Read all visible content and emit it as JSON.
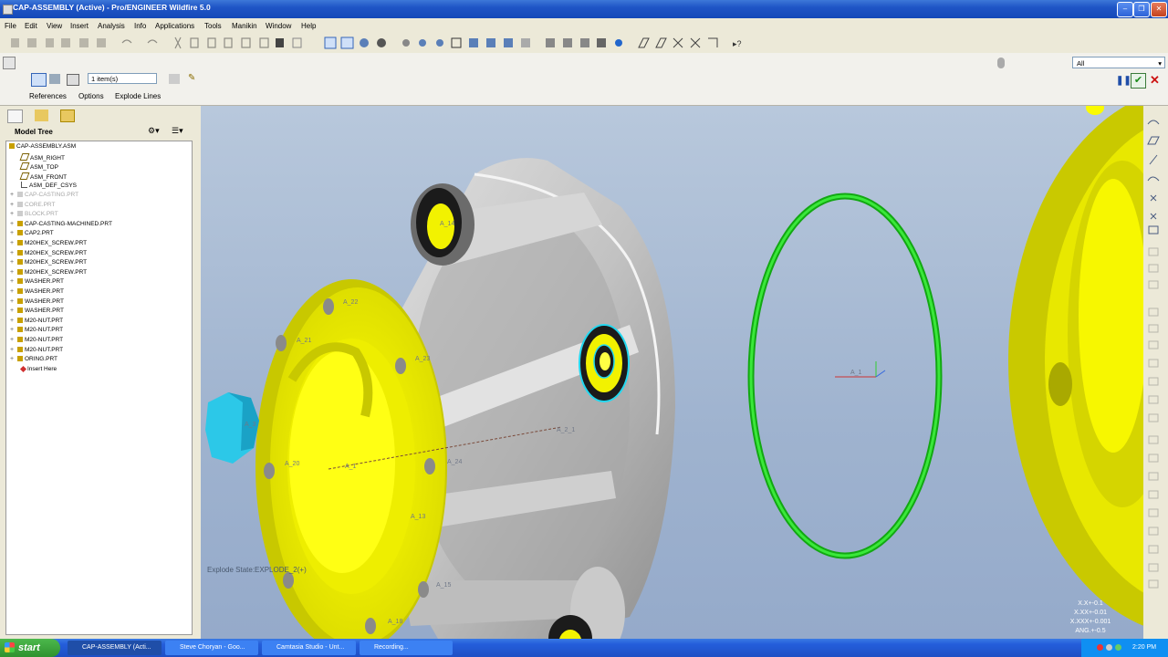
{
  "window": {
    "title": "CAP-ASSEMBLY (Active) - Pro/ENGINEER Wildfire 5.0"
  },
  "menu": [
    "File",
    "Edit",
    "View",
    "Insert",
    "Analysis",
    "Info",
    "Applications",
    "Tools",
    "Manikin",
    "Window",
    "Help"
  ],
  "dashboard": {
    "collector_value": "1 item(s)",
    "tabs": [
      "References",
      "Options",
      "Explode Lines"
    ],
    "filter": "All"
  },
  "model_tree": {
    "title": "Model Tree",
    "items": [
      {
        "label": "CAP-ASSEMBLY.ASM",
        "type": "asm",
        "state": "normal"
      },
      {
        "label": "ASM_RIGHT",
        "type": "plane",
        "state": "normal"
      },
      {
        "label": "ASM_TOP",
        "type": "plane",
        "state": "normal"
      },
      {
        "label": "ASM_FRONT",
        "type": "plane",
        "state": "normal"
      },
      {
        "label": "ASM_DEF_CSYS",
        "type": "csys",
        "state": "normal"
      },
      {
        "label": "CAP-CASTING.PRT",
        "type": "part",
        "state": "hidden"
      },
      {
        "label": "CORE.PRT",
        "type": "part",
        "state": "hidden"
      },
      {
        "label": "BLOCK.PRT",
        "type": "part",
        "state": "hidden"
      },
      {
        "label": "CAP-CASTING-MACHINED.PRT",
        "type": "part",
        "state": "normal"
      },
      {
        "label": "CAP2.PRT",
        "type": "part",
        "state": "normal"
      },
      {
        "label": "M20HEX_SCREW.PRT",
        "type": "part",
        "state": "normal"
      },
      {
        "label": "M20HEX_SCREW.PRT",
        "type": "part",
        "state": "normal"
      },
      {
        "label": "M20HEX_SCREW.PRT",
        "type": "part",
        "state": "normal"
      },
      {
        "label": "M20HEX_SCREW.PRT",
        "type": "part",
        "state": "normal"
      },
      {
        "label": "WASHER.PRT",
        "type": "part",
        "state": "normal"
      },
      {
        "label": "WASHER.PRT",
        "type": "part",
        "state": "normal"
      },
      {
        "label": "WASHER.PRT",
        "type": "part",
        "state": "normal"
      },
      {
        "label": "WASHER.PRT",
        "type": "part",
        "state": "normal"
      },
      {
        "label": "M20-NUT.PRT",
        "type": "part",
        "state": "normal"
      },
      {
        "label": "M20-NUT.PRT",
        "type": "part",
        "state": "normal"
      },
      {
        "label": "M20-NUT.PRT",
        "type": "part",
        "state": "normal"
      },
      {
        "label": "M20-NUT.PRT",
        "type": "part",
        "state": "normal"
      },
      {
        "label": "ORING.PRT",
        "type": "part",
        "state": "normal"
      },
      {
        "label": "Insert Here",
        "type": "insert",
        "state": "normal"
      }
    ]
  },
  "viewport": {
    "explode_state": "Explode State:EXPLODE_2(+)",
    "tolerances": [
      "X.X+-0.1",
      "X.XX+-0.01",
      "X.XXX+-0.001",
      "ANG.+-0.5"
    ],
    "axis_labels": [
      "A_14",
      "A_22",
      "A_21",
      "A_23",
      "A_2_1",
      "A_1",
      "A_20",
      "A_24",
      "A_3",
      "A_13",
      "A_1",
      "A_15",
      "A_18"
    ]
  },
  "taskbar": {
    "start": "start",
    "tasks": [
      "CAP-ASSEMBLY (Acti...",
      "Steve Choryan - Goo...",
      "Camtasia Studio - Unt...",
      "Recording..."
    ],
    "clock": "2:20 PM"
  },
  "colors": {
    "accent_green": "#1fcc1f",
    "part_yellow": "#f2f200",
    "titlebar": "#2357c9"
  }
}
